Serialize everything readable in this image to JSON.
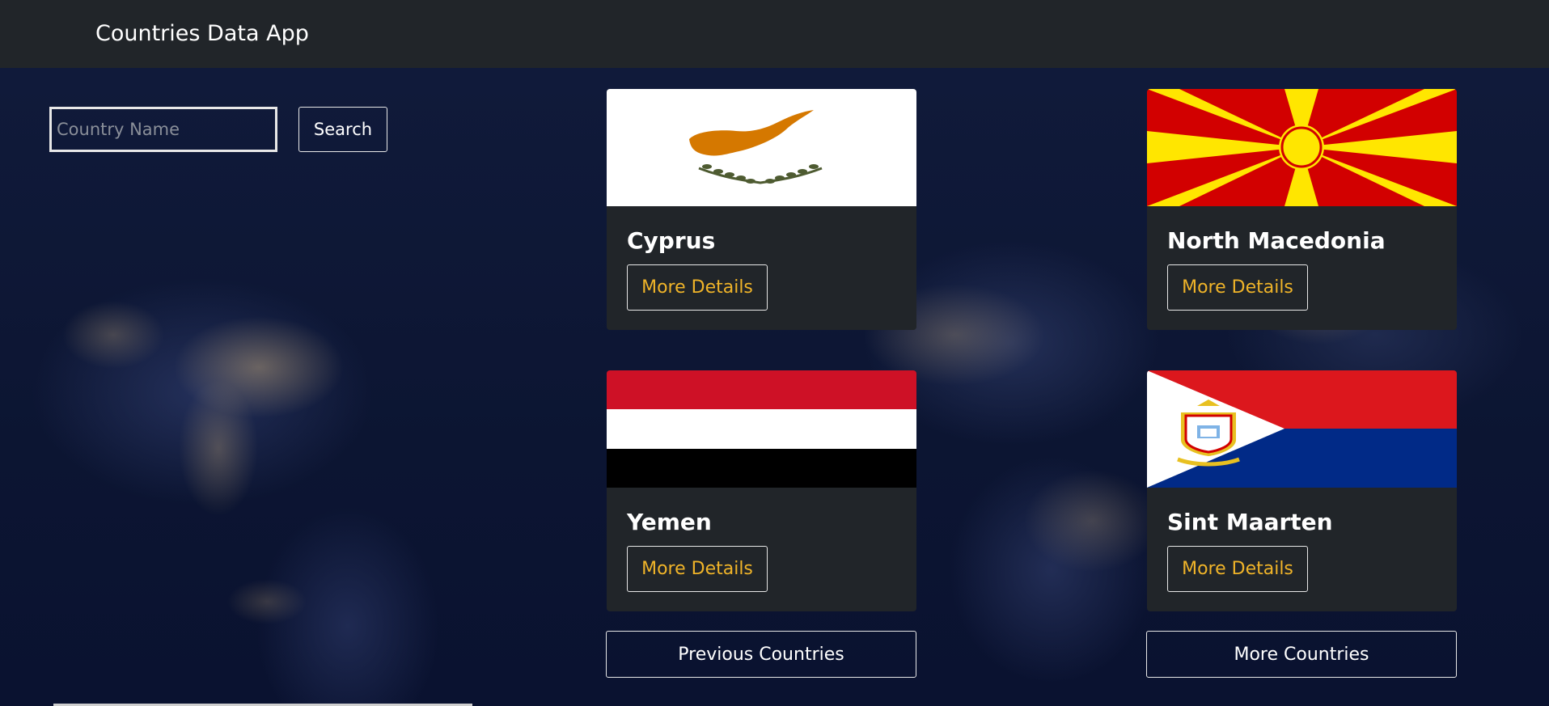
{
  "app": {
    "title": "Countries Data App"
  },
  "search": {
    "placeholder": "Country Name",
    "value": "",
    "button_label": "Search"
  },
  "countries": [
    {
      "name": "Cyprus",
      "details_label": "More Details"
    },
    {
      "name": "North Macedonia",
      "details_label": "More Details"
    },
    {
      "name": "Yemen",
      "details_label": "More Details"
    },
    {
      "name": "Sint Maarten",
      "details_label": "More Details"
    }
  ],
  "pagination": {
    "previous_label": "Previous Countries",
    "next_label": "More Countries"
  },
  "colors": {
    "navbar": "#212529",
    "card": "#212529",
    "details_text": "#f0b429",
    "background": "#0b1430"
  }
}
